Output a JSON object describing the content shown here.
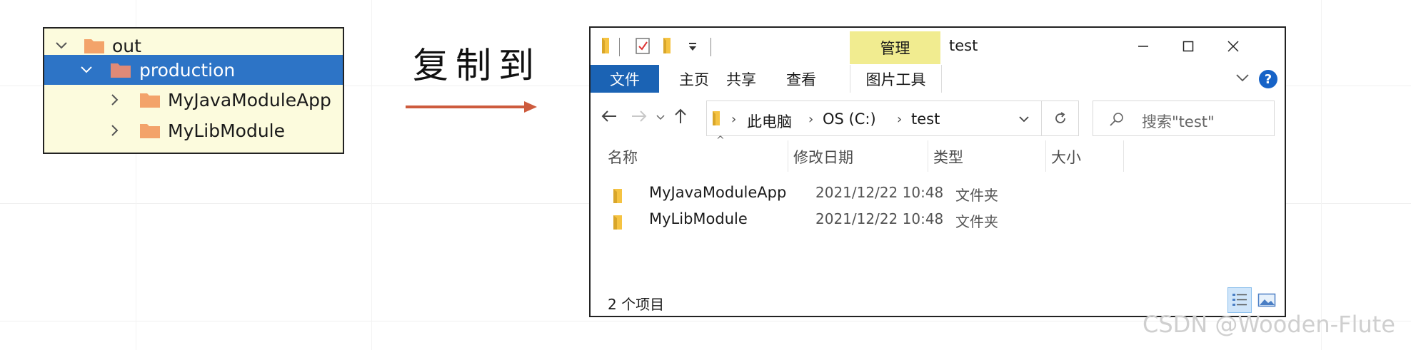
{
  "ide_tree": {
    "rows": [
      {
        "label": "out"
      },
      {
        "label": "production"
      },
      {
        "label": "MyJavaModuleApp"
      },
      {
        "label": "MyLibModule"
      }
    ]
  },
  "caption": "复制到",
  "explorer": {
    "title": "test",
    "context_tab": "管理",
    "ribbon_tabs": [
      "文件",
      "主页",
      "共享",
      "查看",
      "图片工具"
    ],
    "help": "?",
    "address": {
      "crumbs": [
        "此电脑",
        "OS (C:)",
        "test"
      ]
    },
    "search": {
      "placeholder": "搜索\"test\""
    },
    "columns": [
      "名称",
      "修改日期",
      "类型",
      "大小"
    ],
    "files": [
      {
        "name": "MyJavaModuleApp",
        "modified": "2021/12/22 10:48",
        "type": "文件夹",
        "size": ""
      },
      {
        "name": "MyLibModule",
        "modified": "2021/12/22 10:48",
        "type": "文件夹",
        "size": ""
      }
    ],
    "status": "2 个项目"
  },
  "watermark": "CSDN @Wooden-Flute",
  "colors": {
    "tree_bg": "#fcfbdd",
    "tree_selected": "#2d74c6",
    "folder": "#f3a36a",
    "folder_selected": "#e08a77",
    "arrow": "#cd5b3d",
    "ribbon_file": "#1b63b4",
    "context_tab": "#f1ec90",
    "explorer_folder": "#f5c342"
  }
}
